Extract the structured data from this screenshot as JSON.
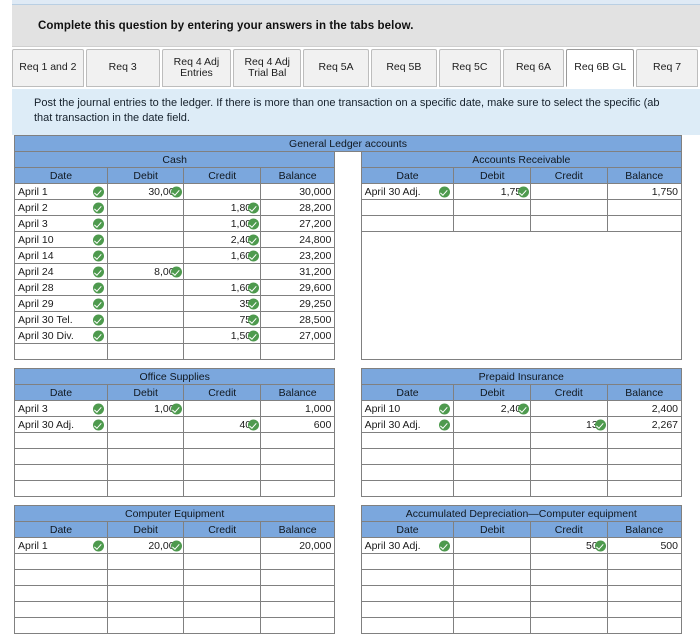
{
  "banner": {
    "text": "Complete this question by entering your answers in the tabs below."
  },
  "tabs": [
    {
      "label": "Req 1 and 2",
      "active": false
    },
    {
      "label": "Req 3",
      "active": false
    },
    {
      "label": "Req 4 Adj Entries",
      "active": false
    },
    {
      "label": "Req 4 Adj Trial Bal",
      "active": false
    },
    {
      "label": "Req 5A",
      "active": false
    },
    {
      "label": "Req 5B",
      "active": false
    },
    {
      "label": "Req 5C",
      "active": false
    },
    {
      "label": "Req 6A",
      "active": false
    },
    {
      "label": "Req 6B GL",
      "active": true
    },
    {
      "label": "Req 7",
      "active": false
    }
  ],
  "instructions": {
    "line1": "Post the journal entries to the ledger. If there is more than one transaction on a specific date, make sure to select the specific (ab",
    "line2": "that transaction in the date field."
  },
  "ledger": {
    "title": "General Ledger accounts",
    "columns": [
      "Date",
      "Debit",
      "Credit",
      "Balance"
    ],
    "accounts": {
      "cash": {
        "name": "Cash",
        "rows": [
          {
            "date": "April 1",
            "debit": "30,000",
            "credit": "",
            "balance": "30,000"
          },
          {
            "date": "April 2",
            "debit": "",
            "credit": "1,800",
            "balance": "28,200"
          },
          {
            "date": "April 3",
            "debit": "",
            "credit": "1,000",
            "balance": "27,200"
          },
          {
            "date": "April 10",
            "debit": "",
            "credit": "2,400",
            "balance": "24,800"
          },
          {
            "date": "April 14",
            "debit": "",
            "credit": "1,600",
            "balance": "23,200"
          },
          {
            "date": "April 24",
            "debit": "8,000",
            "credit": "",
            "balance": "31,200"
          },
          {
            "date": "April 28",
            "debit": "",
            "credit": "1,600",
            "balance": "29,600"
          },
          {
            "date": "April 29",
            "debit": "",
            "credit": "350",
            "balance": "29,250"
          },
          {
            "date": "April 30 Tel.",
            "debit": "",
            "credit": "750",
            "balance": "28,500"
          },
          {
            "date": "April 30 Div.",
            "debit": "",
            "credit": "1,500",
            "balance": "27,000"
          }
        ],
        "empty_rows": 1
      },
      "accounts_receivable": {
        "name": "Accounts Receivable",
        "rows": [
          {
            "date": "April 30 Adj.",
            "debit": "1,750",
            "credit": "",
            "balance": "1,750"
          }
        ],
        "empty_rows": 2
      },
      "office_supplies": {
        "name": "Office Supplies",
        "rows": [
          {
            "date": "April 3",
            "debit": "1,000",
            "credit": "",
            "balance": "1,000"
          },
          {
            "date": "April 30 Adj.",
            "debit": "",
            "credit": "400",
            "balance": "600"
          }
        ],
        "empty_rows": 4
      },
      "prepaid_insurance": {
        "name": "Prepaid Insurance",
        "rows": [
          {
            "date": "April 10",
            "debit": "2,400",
            "credit": "",
            "balance": "2,400"
          },
          {
            "date": "April 30 Adj.",
            "debit": "",
            "credit": "133",
            "balance": "2,267"
          }
        ],
        "empty_rows": 4
      },
      "computer_equipment": {
        "name": "Computer Equipment",
        "rows": [
          {
            "date": "April 1",
            "debit": "20,000",
            "credit": "",
            "balance": "20,000"
          }
        ],
        "empty_rows": 5
      },
      "accumulated_depreciation": {
        "name": "Accumulated Depreciation—Computer equipment",
        "rows": [
          {
            "date": "April 30 Adj.",
            "debit": "",
            "credit": "500",
            "balance": "500"
          }
        ],
        "empty_rows": 5
      }
    }
  },
  "colors": {
    "header_blue": "#7ba7dd",
    "instruction_bg": "#ddecf7",
    "banner_bg": "#e2e2e2",
    "check_green": "#4e9a4e"
  },
  "icons": {
    "check": "check-circle-icon"
  }
}
